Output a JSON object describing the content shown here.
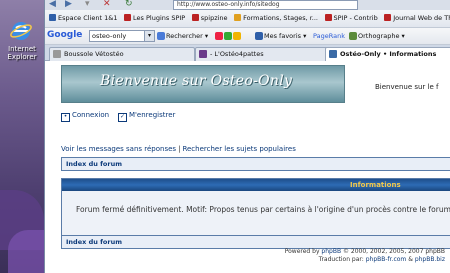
{
  "desktop": {
    "ie_label": "Internet Explorer"
  },
  "address_bar": {
    "url": "http://www.osteo-only.info/sitedog"
  },
  "bookmarks": [
    "Espace Client 1&1",
    "Les Plugins SPIP",
    "spipzine",
    "Formations, Stages, r...",
    "SPIP - Contrib",
    "Journal Web de Thier..."
  ],
  "google_bar": {
    "logo": "Google",
    "search_value": "osteo-only",
    "search_label": "Rechercher",
    "favorites_label": "Mes favoris",
    "pagerank_label": "PageRank",
    "spelling_label": "Orthographe"
  },
  "tabs": [
    {
      "label": "Boussole Vétostéo",
      "active": false
    },
    {
      "label": "- L'Ostéo4pattes",
      "active": false
    },
    {
      "label": "Ostéo-Only • Informations",
      "active": true
    }
  ],
  "page": {
    "banner_title": "Bienvenue sur Osteo-Only",
    "welcome_text": "Bienvenue sur le f",
    "login_link": "Connexion",
    "register_link": "M'enregistrer",
    "unanswered_link": "Voir les messages sans réponses",
    "separator": "|",
    "popular_link": "Rechercher les sujets populaires",
    "forum_index_top": "Index du forum",
    "info_header": "Informations",
    "info_message": "Forum fermé définitivement. Motif: Propos tenus par certains à l'origine d'un procès contre le forum.",
    "forum_index_bottom": "Index du forum",
    "footer_powered_prefix": "Powered by",
    "footer_powered_link": "phpBB",
    "footer_powered_suffix": "© 2000, 2002, 2005, 2007 phpBB",
    "footer_translation_prefix": "Traduction par:",
    "footer_translation_link1": "phpBB-fr.com",
    "footer_translation_sep": "&",
    "footer_translation_link2": "phpBB.biz"
  },
  "colors": {
    "link": "#0c3a7a",
    "info_header_bg": "#2d6bb5",
    "info_header_text": "#f2c94c",
    "banner": "#6f9aa6"
  }
}
